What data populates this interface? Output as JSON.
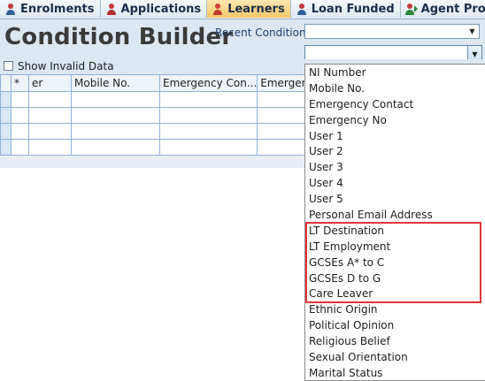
{
  "tabs": [
    {
      "label": "Enrolments",
      "icon": "enrolments-icon",
      "active": false
    },
    {
      "label": "Applications",
      "icon": "applications-icon",
      "active": false
    },
    {
      "label": "Learners",
      "icon": "learners-icon",
      "active": true
    },
    {
      "label": "Loan Funded",
      "icon": "loan-funded-icon",
      "active": false
    },
    {
      "label": "Agent Progression",
      "icon": "agent-progression-icon",
      "active": false
    }
  ],
  "header": {
    "title": "Condition Builder",
    "recent_conditions_label": "Recent Conditions",
    "recent_conditions_value": "",
    "field_combo_value": ""
  },
  "options": {
    "show_invalid_label": "Show Invalid Data",
    "show_invalid_checked": false
  },
  "grid": {
    "row_header_label": "*",
    "columns": [
      "er",
      "Mobile No.",
      "Emergency Con...",
      "Emergency"
    ],
    "row_count": 4
  },
  "dropdown": {
    "items": [
      "NI Number",
      "Mobile No.",
      "Emergency Contact",
      "Emergency No",
      "User 1",
      "User 2",
      "User 3",
      "User 4",
      "User 5",
      "Personal Email Address",
      "LT Destination",
      "LT Employment",
      "GCSEs A* to C",
      "GCSEs D to G",
      "Care Leaver",
      "Ethnic Origin",
      "Political Opinion",
      "Religious Belief",
      "Sexual Orientation",
      "Marital Status"
    ],
    "highlighted_items": [
      "LT Destination",
      "LT Employment",
      "GCSEs A* to C",
      "GCSEs D to G",
      "Care Leaver"
    ]
  },
  "colors": {
    "accent_highlight": "#e2343a",
    "active_tab": "#f8c66a",
    "header_bg": "#dde7f1",
    "grid_border": "#8db2d8"
  }
}
